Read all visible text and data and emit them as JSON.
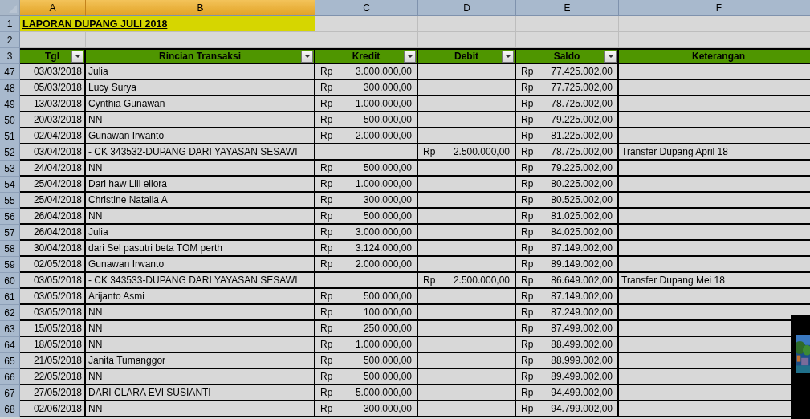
{
  "column_headers": [
    {
      "letter": "A",
      "selected": true
    },
    {
      "letter": "B",
      "selected": true
    },
    {
      "letter": "C",
      "selected": false
    },
    {
      "letter": "D",
      "selected": false
    },
    {
      "letter": "E",
      "selected": false
    },
    {
      "letter": "F",
      "selected": false
    }
  ],
  "title_row": {
    "row": "1",
    "title": "LAPORAN DUPANG JULI 2018"
  },
  "blank_row": {
    "row": "2"
  },
  "table_header": {
    "row": "3",
    "columns": [
      {
        "label": "Tgl",
        "filter": true
      },
      {
        "label": "Rincian Transaksi",
        "filter": true
      },
      {
        "label": "Kredit",
        "filter": true
      },
      {
        "label": "Debit",
        "filter": true
      },
      {
        "label": "Saldo",
        "filter": true
      },
      {
        "label": "Keterangan",
        "filter": false
      }
    ]
  },
  "rows": [
    {
      "row": "47",
      "tgl": "03/03/2018",
      "rincian": "Julia",
      "kredit": {
        "currency": "Rp",
        "amount": "3.000.000,00"
      },
      "saldo": {
        "currency": "Rp",
        "amount": "77.425.002,00"
      }
    },
    {
      "row": "48",
      "tgl": "05/03/2018",
      "rincian": "Lucy Surya",
      "kredit": {
        "currency": "Rp",
        "amount": "300.000,00"
      },
      "saldo": {
        "currency": "Rp",
        "amount": "77.725.002,00"
      }
    },
    {
      "row": "49",
      "tgl": "13/03/2018",
      "rincian": "Cynthia Gunawan",
      "kredit": {
        "currency": "Rp",
        "amount": "1.000.000,00"
      },
      "saldo": {
        "currency": "Rp",
        "amount": "78.725.002,00"
      }
    },
    {
      "row": "50",
      "tgl": "20/03/2018",
      "rincian": "NN",
      "kredit": {
        "currency": "Rp",
        "amount": "500.000,00"
      },
      "saldo": {
        "currency": "Rp",
        "amount": "79.225.002,00"
      }
    },
    {
      "row": "51",
      "tgl": "02/04/2018",
      "rincian": "Gunawan Irwanto",
      "kredit": {
        "currency": "Rp",
        "amount": "2.000.000,00"
      },
      "saldo": {
        "currency": "Rp",
        "amount": "81.225.002,00"
      }
    },
    {
      "row": "52",
      "tgl": "03/04/2018",
      "rincian": "- CK 343532-DUPANG DARI YAYASAN SESAWI",
      "debit": {
        "currency": "Rp",
        "amount": "2.500.000,00"
      },
      "saldo": {
        "currency": "Rp",
        "amount": "78.725.002,00"
      },
      "keterangan": "Transfer Dupang April 18"
    },
    {
      "row": "53",
      "tgl": "24/04/2018",
      "rincian": "NN",
      "kredit": {
        "currency": "Rp",
        "amount": "500.000,00"
      },
      "saldo": {
        "currency": "Rp",
        "amount": "79.225.002,00"
      }
    },
    {
      "row": "54",
      "tgl": "25/04/2018",
      "rincian": "Dari haw Lili eliora",
      "kredit": {
        "currency": "Rp",
        "amount": "1.000.000,00"
      },
      "saldo": {
        "currency": "Rp",
        "amount": "80.225.002,00"
      }
    },
    {
      "row": "55",
      "tgl": "25/04/2018",
      "rincian": "Christine Natalia A",
      "kredit": {
        "currency": "Rp",
        "amount": "300.000,00"
      },
      "saldo": {
        "currency": "Rp",
        "amount": "80.525.002,00"
      }
    },
    {
      "row": "56",
      "tgl": "26/04/2018",
      "rincian": "NN",
      "kredit": {
        "currency": "Rp",
        "amount": "500.000,00"
      },
      "saldo": {
        "currency": "Rp",
        "amount": "81.025.002,00"
      }
    },
    {
      "row": "57",
      "tgl": "26/04/2018",
      "rincian": "Julia",
      "kredit": {
        "currency": "Rp",
        "amount": "3.000.000,00"
      },
      "saldo": {
        "currency": "Rp",
        "amount": "84.025.002,00"
      }
    },
    {
      "row": "58",
      "tgl": "30/04/2018",
      "rincian": "dari Sel pasutri beta TOM perth",
      "kredit": {
        "currency": "Rp",
        "amount": "3.124.000,00"
      },
      "saldo": {
        "currency": "Rp",
        "amount": "87.149.002,00"
      }
    },
    {
      "row": "59",
      "tgl": "02/05/2018",
      "rincian": "Gunawan Irwanto",
      "kredit": {
        "currency": "Rp",
        "amount": "2.000.000,00"
      },
      "saldo": {
        "currency": "Rp",
        "amount": "89.149.002,00"
      }
    },
    {
      "row": "60",
      "tgl": "03/05/2018",
      "rincian": "- CK 343533-DUPANG DARI YAYASAN SESAWI",
      "debit": {
        "currency": "Rp",
        "amount": "2.500.000,00"
      },
      "saldo": {
        "currency": "Rp",
        "amount": "86.649.002,00"
      },
      "keterangan": "Transfer Dupang Mei 18"
    },
    {
      "row": "61",
      "tgl": "03/05/2018",
      "rincian": "Arijanto Asmi",
      "kredit": {
        "currency": "Rp",
        "amount": "500.000,00"
      },
      "saldo": {
        "currency": "Rp",
        "amount": "87.149.002,00"
      }
    },
    {
      "row": "62",
      "tgl": "03/05/2018",
      "rincian": "NN",
      "kredit": {
        "currency": "Rp",
        "amount": "100.000,00"
      },
      "saldo": {
        "currency": "Rp",
        "amount": "87.249.002,00"
      }
    },
    {
      "row": "63",
      "tgl": "15/05/2018",
      "rincian": "NN",
      "kredit": {
        "currency": "Rp",
        "amount": "250.000,00"
      },
      "saldo": {
        "currency": "Rp",
        "amount": "87.499.002,00"
      }
    },
    {
      "row": "64",
      "tgl": "18/05/2018",
      "rincian": "NN",
      "kredit": {
        "currency": "Rp",
        "amount": "1.000.000,00"
      },
      "saldo": {
        "currency": "Rp",
        "amount": "88.499.002,00"
      }
    },
    {
      "row": "65",
      "tgl": "21/05/2018",
      "rincian": "Janita Tumanggor",
      "kredit": {
        "currency": "Rp",
        "amount": "500.000,00"
      },
      "saldo": {
        "currency": "Rp",
        "amount": "88.999.002,00"
      }
    },
    {
      "row": "66",
      "tgl": "22/05/2018",
      "rincian": "NN",
      "kredit": {
        "currency": "Rp",
        "amount": "500.000,00"
      },
      "saldo": {
        "currency": "Rp",
        "amount": "89.499.002,00"
      }
    },
    {
      "row": "67",
      "tgl": "27/05/2018",
      "rincian": "DARI CLARA EVI SUSIANTI",
      "kredit": {
        "currency": "Rp",
        "amount": "5.000.000,00"
      },
      "saldo": {
        "currency": "Rp",
        "amount": "94.499.002,00"
      }
    },
    {
      "row": "68",
      "tgl": "02/06/2018",
      "rincian": "NN",
      "kredit": {
        "currency": "Rp",
        "amount": "300.000,00"
      },
      "saldo": {
        "currency": "Rp",
        "amount": "94.799.002,00"
      }
    }
  ]
}
